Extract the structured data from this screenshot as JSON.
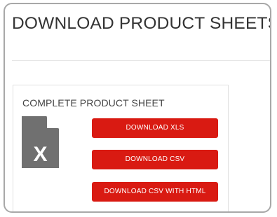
{
  "page": {
    "title": "DOWNLOAD PRODUCT SHEETS"
  },
  "section": {
    "title": "COMPLETE PRODUCT SHEET",
    "file_icon": {
      "name": "excel-file-icon",
      "letter": "X",
      "color": "#707070"
    }
  },
  "buttons": {
    "xls_label": "DOWNLOAD XLS",
    "csv_label": "DOWNLOAD CSV",
    "csv_html_label": "DOWNLOAD CSV WITH HTML"
  },
  "colors": {
    "button_bg": "#d91a12",
    "button_text": "#ffffff",
    "title_text": "#333333"
  }
}
